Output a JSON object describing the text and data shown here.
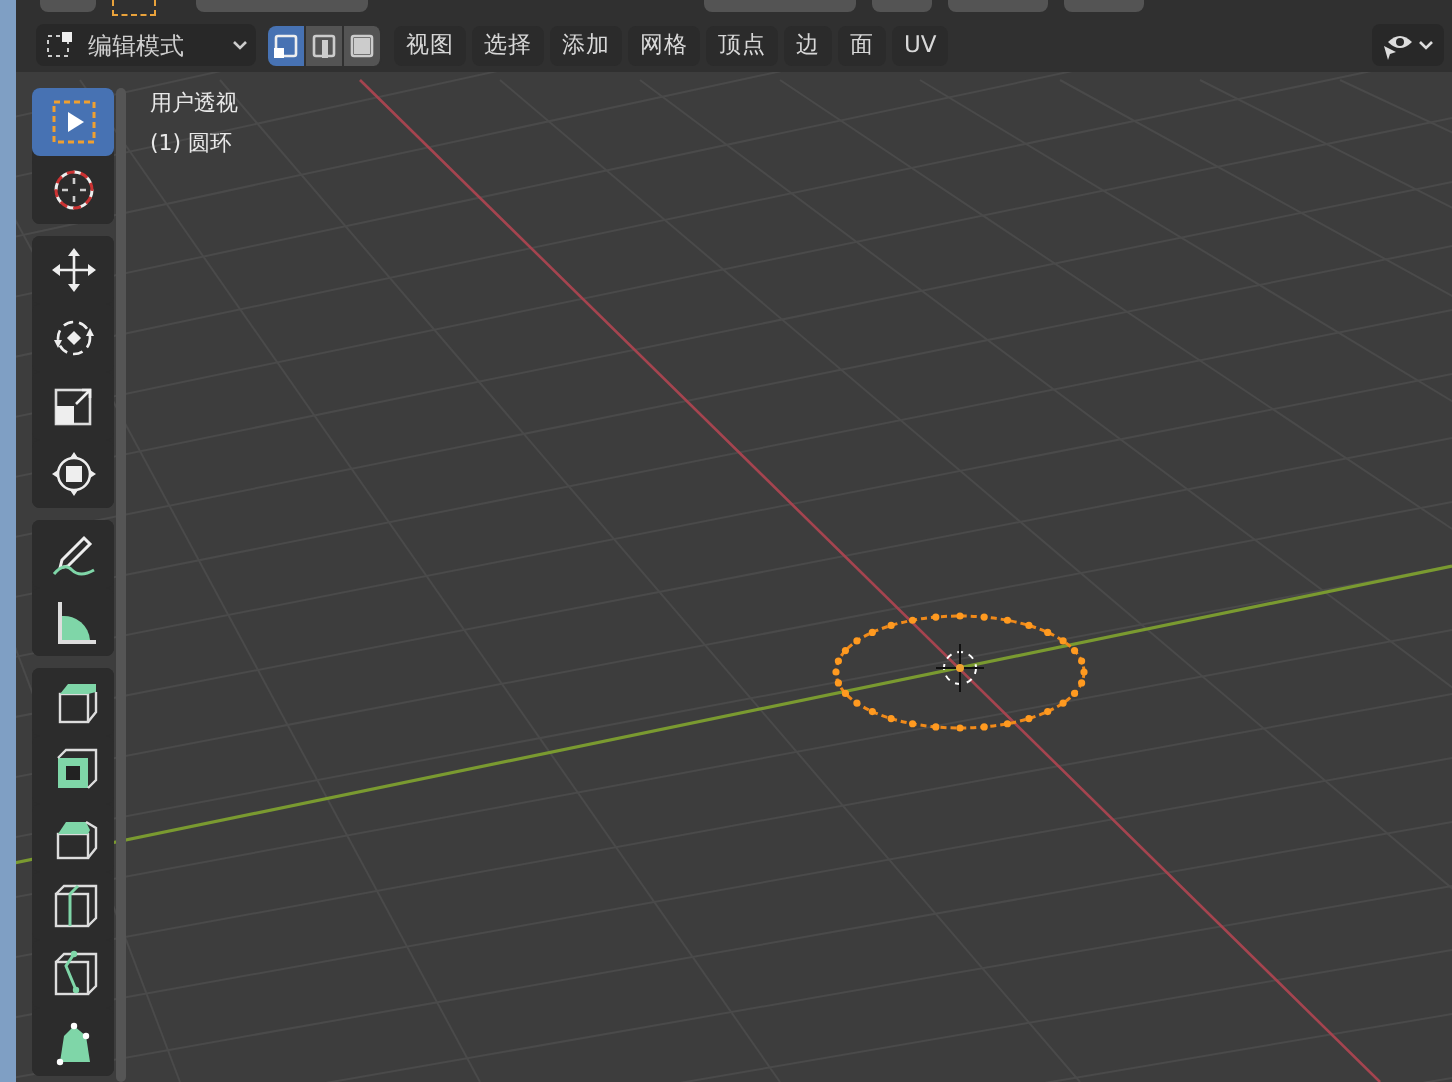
{
  "header": {
    "mode_dropdown": {
      "label": "编辑模式"
    },
    "select_modes": [
      {
        "kind": "vertex",
        "selected": true
      },
      {
        "kind": "edge",
        "selected": false
      },
      {
        "kind": "face",
        "selected": false
      }
    ],
    "menus": [
      "视图",
      "选择",
      "添加",
      "网格",
      "顶点",
      "边",
      "面",
      "UV"
    ]
  },
  "viewport": {
    "view_name": "用户透视",
    "object_name": "(1) 圆环"
  },
  "toolbar": {
    "groups": [
      [
        {
          "kind": "select-box",
          "selected": true
        },
        {
          "kind": "cursor",
          "selected": false
        }
      ],
      [
        {
          "kind": "move",
          "selected": false
        },
        {
          "kind": "rotate",
          "selected": false
        },
        {
          "kind": "scale",
          "selected": false
        },
        {
          "kind": "transform",
          "selected": false
        }
      ],
      [
        {
          "kind": "annotate",
          "selected": false
        },
        {
          "kind": "measure",
          "selected": false
        }
      ],
      [
        {
          "kind": "extrude",
          "selected": false
        },
        {
          "kind": "inset",
          "selected": false
        },
        {
          "kind": "bevel",
          "selected": false
        },
        {
          "kind": "loop-cut",
          "selected": false
        },
        {
          "kind": "knife",
          "selected": false
        },
        {
          "kind": "poly-build",
          "selected": false
        }
      ]
    ]
  }
}
